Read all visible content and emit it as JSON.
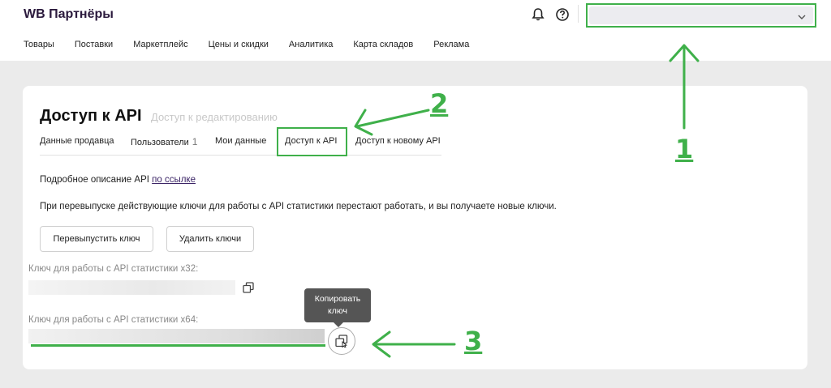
{
  "header": {
    "logo": "WB Партнёры",
    "account_value": "",
    "nav": [
      "Товары",
      "Поставки",
      "Маркетплейс",
      "Цены и скидки",
      "Аналитика",
      "Карта складов",
      "Реклама"
    ]
  },
  "page": {
    "title": "Доступ к API",
    "subtitle": "Доступ к редактированию",
    "tabs": [
      {
        "label": "Данные продавца"
      },
      {
        "label": "Пользователи",
        "badge": "1"
      },
      {
        "label": "Мои данные"
      },
      {
        "label": "Доступ к API"
      },
      {
        "label": "Доступ к новому API"
      }
    ],
    "description_prefix": "Подробное описание API",
    "description_link": "по ссылке",
    "notice": "При перевыпуске действующие ключи для работы с API статистики перестают работать, и вы получаете новые ключи.",
    "btn_reissue": "Перевыпустить ключ",
    "btn_delete": "Удалить ключи",
    "key32_label": "Ключ для работы с API статистики x32:",
    "key64_label": "Ключ для работы с API статистики x64:",
    "tooltip": "Копировать ключ"
  },
  "annotations": {
    "n1": "1",
    "n2": "2",
    "n3": "3"
  },
  "colors": {
    "accent_green": "#3fb04a",
    "brand_purple": "#2b1a3d"
  }
}
